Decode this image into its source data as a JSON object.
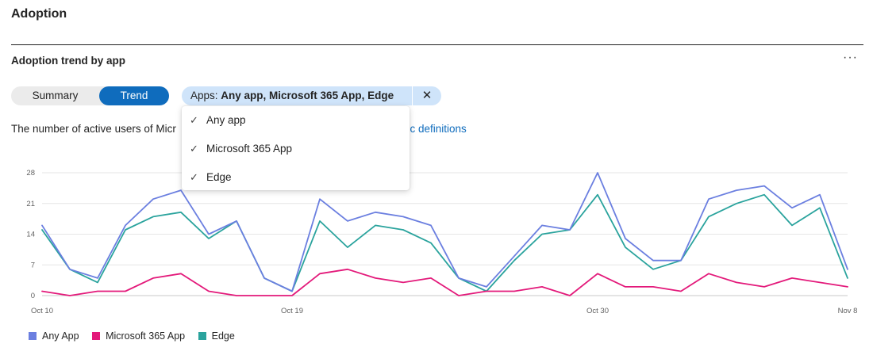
{
  "page": {
    "title": "Adoption",
    "section_title": "Adoption trend by app",
    "more_label": "···"
  },
  "toggle": {
    "summary_label": "Summary",
    "trend_label": "Trend",
    "selected": "Trend"
  },
  "filter": {
    "prefix": "Apps:",
    "value": "Any app, Microsoft 365 App, Edge",
    "clear_icon": "close-icon"
  },
  "description": {
    "text": "The number of active users of Micr",
    "link_text": "ric definitions"
  },
  "dropdown": {
    "check_icon": "✓",
    "options": [
      {
        "label": "Any app",
        "checked": true
      },
      {
        "label": "Microsoft 365 App",
        "checked": true
      },
      {
        "label": "Edge",
        "checked": true
      }
    ]
  },
  "legend": {
    "items": [
      {
        "label": "Any App",
        "color": "#6b7fe0"
      },
      {
        "label": "Microsoft 365 App",
        "color": "#e3197a"
      },
      {
        "label": "Edge",
        "color": "#2aa39d"
      }
    ]
  },
  "chart_data": {
    "type": "line",
    "x_tick_labels": [
      "Oct 10",
      "Oct 19",
      "Oct 30",
      "Nov 8"
    ],
    "x": [
      "Oct 10",
      "Oct 11",
      "Oct 12",
      "Oct 13",
      "Oct 14",
      "Oct 15",
      "Oct 16",
      "Oct 17",
      "Oct 18",
      "Oct 19",
      "Oct 20",
      "Oct 21",
      "Oct 22",
      "Oct 23",
      "Oct 24",
      "Oct 25",
      "Oct 26",
      "Oct 27",
      "Oct 28",
      "Oct 29",
      "Oct 30",
      "Oct 31",
      "Nov 1",
      "Nov 2",
      "Nov 3",
      "Nov 4",
      "Nov 5",
      "Nov 6",
      "Nov 7",
      "Nov 8"
    ],
    "ylim": [
      0,
      28
    ],
    "yticks": [
      0,
      7,
      14,
      21,
      28
    ],
    "grid": true,
    "legend_position": "bottom-left",
    "series": [
      {
        "name": "Any App",
        "color": "#6b7fe0",
        "values": [
          16,
          6,
          4,
          16,
          22,
          24,
          14,
          17,
          4,
          1,
          22,
          17,
          19,
          18,
          16,
          4,
          2,
          9,
          16,
          15,
          28,
          13,
          8,
          8,
          22,
          24,
          25,
          20,
          23,
          6
        ]
      },
      {
        "name": "Microsoft 365 App",
        "color": "#e3197a",
        "values": [
          1,
          0,
          1,
          1,
          4,
          5,
          1,
          0,
          0,
          0,
          5,
          6,
          4,
          3,
          4,
          0,
          1,
          1,
          2,
          0,
          5,
          2,
          2,
          1,
          5,
          3,
          2,
          4,
          3,
          2
        ]
      },
      {
        "name": "Edge",
        "color": "#2aa39d",
        "values": [
          15,
          6,
          3,
          15,
          18,
          19,
          13,
          17,
          4,
          1,
          17,
          11,
          16,
          15,
          12,
          4,
          1,
          8,
          14,
          15,
          23,
          11,
          6,
          8,
          18,
          21,
          23,
          16,
          20,
          4
        ]
      }
    ]
  }
}
